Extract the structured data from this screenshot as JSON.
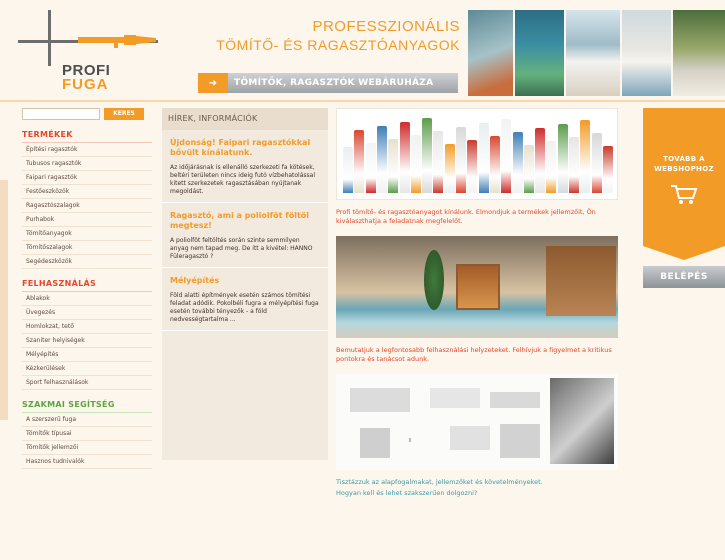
{
  "header": {
    "logo_word_1": "PROFI",
    "logo_word_2": "FUGA",
    "slogan_line_1": "PROFESSZIONÁLIS",
    "slogan_line_2": "TÖMÍTŐ- ÉS RAGASZTÓANYAGOK",
    "tagline": "TÖMÍTŐK, RAGASZTÓK WEBÁRUHÁZA"
  },
  "colors": {
    "accent": "#f29b26",
    "heading_red": "#e3482c",
    "heading_green": "#5aa63e",
    "caption_teal": "#3a9aa7"
  },
  "search": {
    "button": "KERES"
  },
  "sidebar": {
    "termekek": {
      "title": "TERMÉKEK",
      "items": [
        "Építési ragasztók",
        "Tubusos ragasztók",
        "Faipari ragasztók",
        "Festőeszközök",
        "Ragasztószalagok",
        "Purhabok",
        "Tömítőanyagok",
        "Tömítőszalagok",
        "Segédeszközök"
      ]
    },
    "felhasznalas": {
      "title": "FELHASZNÁLÁS",
      "items": [
        "Ablakok",
        "Üvegezés",
        "Homlokzat, tető",
        "Szaniter helyiségek",
        "Mélyépítés",
        "Kézkerülések",
        "Sport felhasználások"
      ]
    },
    "szakmai": {
      "title": "SZAKMAI SEGÍTSÉG",
      "items": [
        "A szerszerű fuga",
        "Tömítők típusai",
        "Tömítők jellemzői",
        "Hasznos tudnivalók"
      ]
    }
  },
  "news": {
    "heading": "HÍREK, INFORMÁCIÓK",
    "items": [
      {
        "title": "Újdonság! Faipari ragasztókkal bővült kínálatunk.",
        "body": "Az időjárásnak is ellenálló szerkezeti fa kötések, beltéri területen nincs ideig futó vízbehatolással kitett szerkezetek ragasztásában nyújtanak megoldást."
      },
      {
        "title": "Ragasztó, ami a poliolföt föltöl megtesz!",
        "body": "A poliolföt feltöltés során szinte semmilyen anyag nem tapad meg. De itt a kivétel: HANNO Füleragasztó ?"
      },
      {
        "title": "Mélyépítés",
        "body": "Föld alatti építmények esetén számos tömítési feladat adódik. Pokolbéli fugra a mélyépítési fuga esetén további tényezők - a föld nedvességtartalma ..."
      }
    ]
  },
  "content": {
    "caption_1": "Profi tömítő- és ragasztóanyagot kínálunk. Elmondjuk a termékek jellemzőit, Ön kiválaszthatja a feladatnak megfelelőt.",
    "caption_2": "Bemutatjuk a legfontosabb felhasználási helyzeteket. Felhívjuk a figyelmet a kritikus pontokra és tanácsot adunk.",
    "caption_3": "Tisztázzuk az alapfogalmakat, jellemzőket és követelményeket.",
    "caption_4": "Hogyan kell és lehet szakszerűen dolgozni?"
  },
  "shop": {
    "banner_line_1": "TOVÁBB A",
    "banner_line_2": "WEBSHOPHOZ",
    "login": "BELÉPÉS",
    "cart_icon": "shopping-cart-icon"
  }
}
